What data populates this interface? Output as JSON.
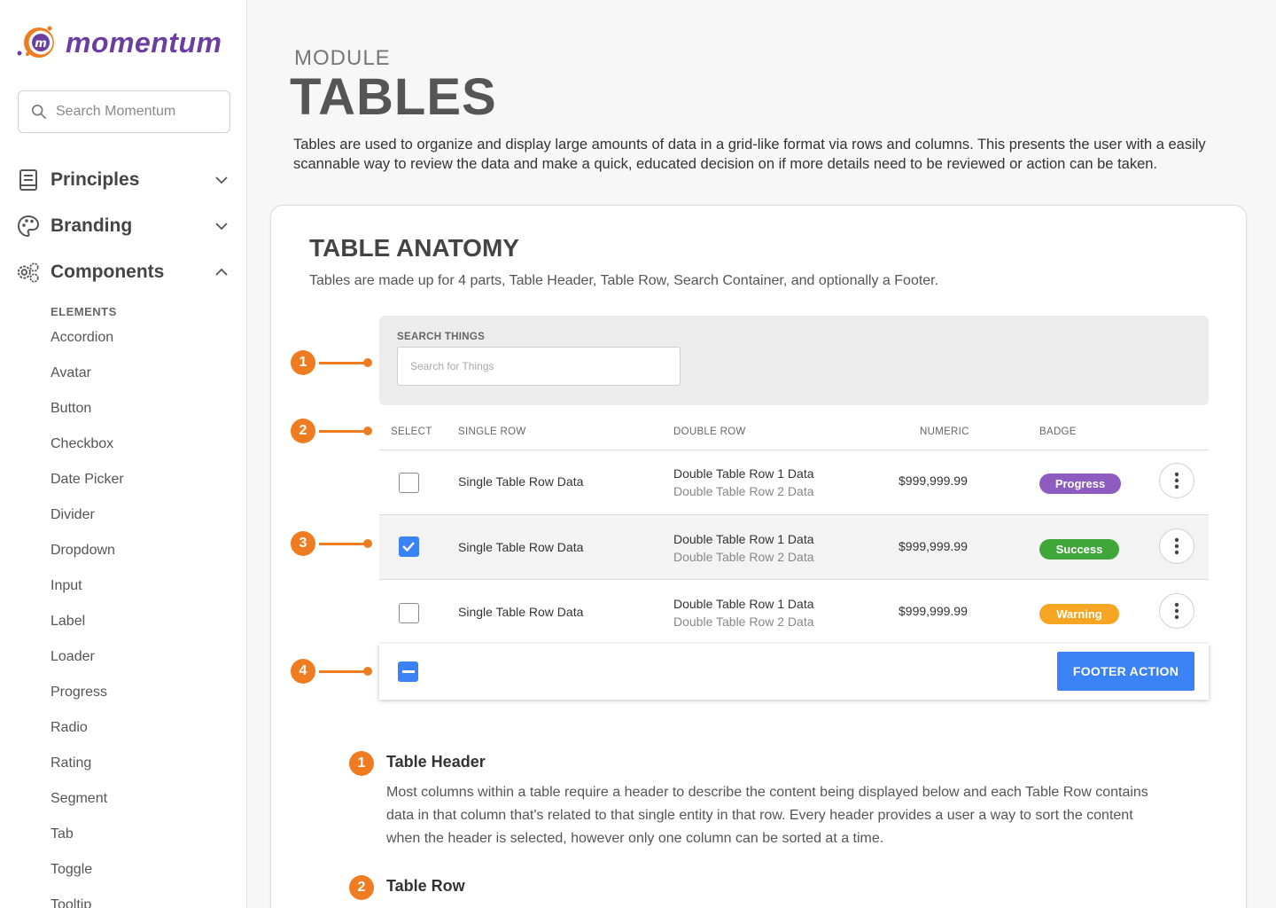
{
  "brand": {
    "name": "momentum",
    "accent": "#f07c21",
    "purple": "#6b3fa0",
    "blue": "#3b82f6"
  },
  "sidebar": {
    "search_placeholder": "Search Momentum",
    "sections": [
      {
        "label": "Principles",
        "icon": "book-icon",
        "expanded": false
      },
      {
        "label": "Branding",
        "icon": "palette-icon",
        "expanded": false
      },
      {
        "label": "Components",
        "icon": "gears-icon",
        "expanded": true
      }
    ],
    "group_label": "ELEMENTS",
    "items": [
      "Accordion",
      "Avatar",
      "Button",
      "Checkbox",
      "Date Picker",
      "Divider",
      "Dropdown",
      "Input",
      "Label",
      "Loader",
      "Progress",
      "Radio",
      "Rating",
      "Segment",
      "Tab",
      "Toggle",
      "Tooltip"
    ]
  },
  "page": {
    "eyebrow": "MODULE",
    "title": "TABLES",
    "description": "Tables are used to organize and display large amounts of data in a grid-like format via rows and columns. This presents the user with a easily scannable way to review the data and make a quick, educated decision on if more details need to be reviewed or action can be taken."
  },
  "anatomy": {
    "title": "TABLE ANATOMY",
    "description": "Tables are made up for 4 parts, Table Header, Table Row, Search Container, and optionally a Footer.",
    "markers": [
      "1",
      "2",
      "3",
      "4"
    ],
    "search": {
      "label": "SEARCH THINGS",
      "placeholder": "Search for Things"
    },
    "columns": [
      "SELECT",
      "SINGLE ROW",
      "DOUBLE ROW",
      "NUMERIC",
      "BADGE"
    ],
    "rows": [
      {
        "checked": false,
        "single": "Single Table Row Data",
        "double1": "Double Table Row 1 Data",
        "double2": "Double Table Row 2 Data",
        "numeric": "$999,999.99",
        "badge": "Progress",
        "badge_color": "#8e5cc0"
      },
      {
        "checked": true,
        "single": "Single Table Row Data",
        "double1": "Double Table Row 1 Data",
        "double2": "Double Table Row 2 Data",
        "numeric": "$999,999.99",
        "badge": "Success",
        "badge_color": "#3fa63a"
      },
      {
        "checked": false,
        "single": "Single Table Row Data",
        "double1": "Double Table Row 1 Data",
        "double2": "Double Table Row 2 Data",
        "numeric": "$999,999.99",
        "badge": "Warning",
        "badge_color": "#f6a623"
      }
    ],
    "footer_action": "FOOTER ACTION"
  },
  "descriptions": [
    {
      "num": "1",
      "title": "Table Header",
      "body": "Most columns within a table require a header to describe the content being displayed below and each Table Row contains data in that column that's related to that single entity in that row. Every header provides a user a way to sort the content when the header is selected, however only one column can be sorted at a time."
    },
    {
      "num": "2",
      "title": "Table Row",
      "body": ""
    }
  ]
}
